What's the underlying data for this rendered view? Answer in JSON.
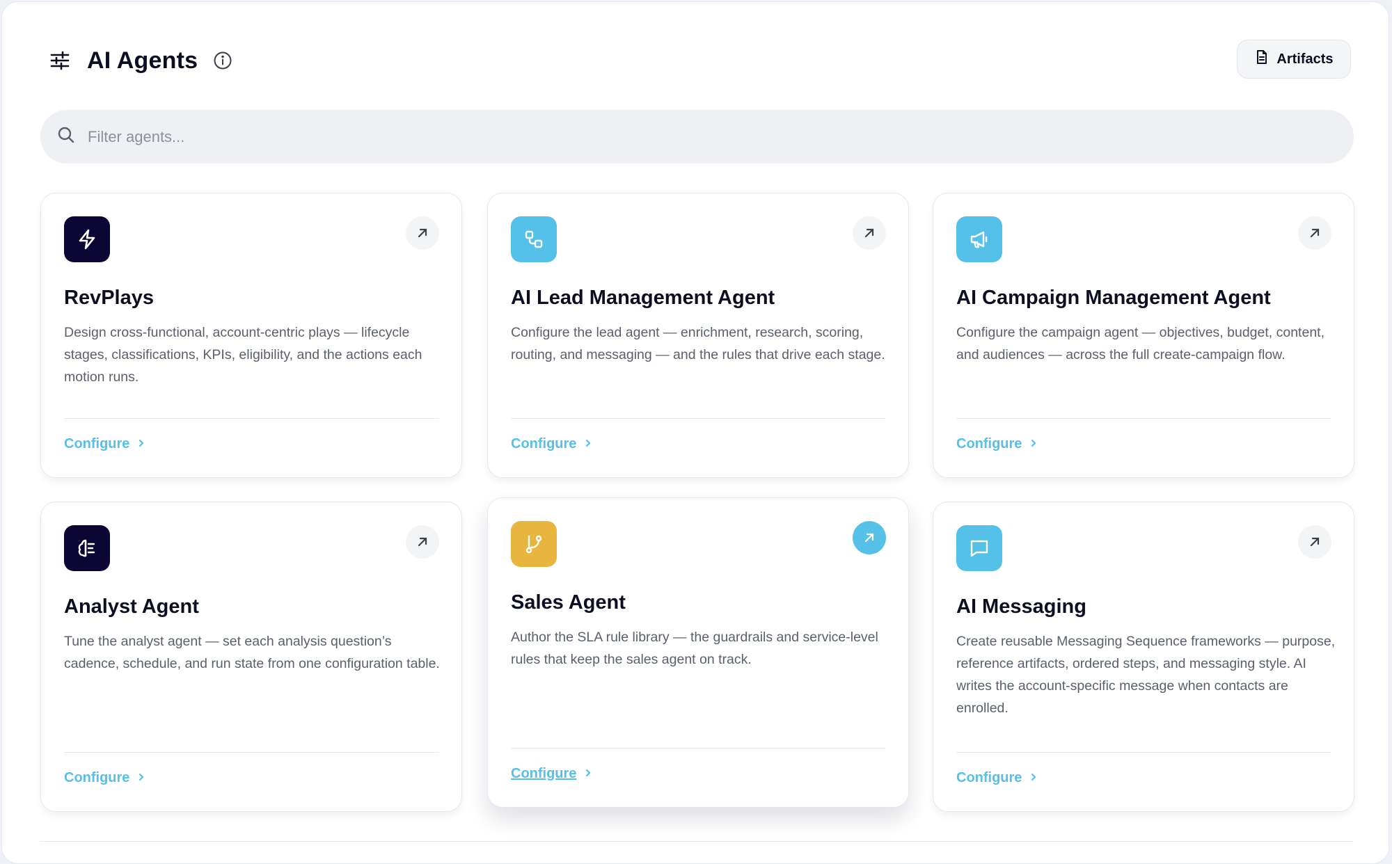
{
  "header": {
    "title": "AI Agents"
  },
  "toolbar": {
    "artifacts_label": "Artifacts"
  },
  "search": {
    "placeholder": "Filter agents..."
  },
  "colors": {
    "accent": "#55c0e8",
    "navy": "#0b0633",
    "amber": "#e8b53e"
  },
  "cards": [
    {
      "title": "RevPlays",
      "description": "Design cross-functional, account-centric plays — lifecycle stages, classifications, KPIs, eligibility, and the actions each motion runs.",
      "icon": "lightning-icon",
      "icon_color": "#0b0633",
      "configure_label": "Configure"
    },
    {
      "title": "AI Lead Management Agent",
      "description": "Configure the lead agent — enrichment, research, scoring, routing, and messaging — and the rules that drive each stage.",
      "icon": "workflow-icon",
      "icon_color": "#55c0e8",
      "configure_label": "Configure"
    },
    {
      "title": "AI Campaign Management Agent",
      "description": "Configure the campaign agent — objectives, budget, content, and audiences — across the full create-campaign flow.",
      "icon": "megaphone-icon",
      "icon_color": "#55c0e8",
      "configure_label": "Configure"
    },
    {
      "title": "Analyst Agent",
      "description": "Tune the analyst agent — set each analysis question’s cadence, schedule, and run state from one configuration table.",
      "icon": "brain-icon",
      "icon_color": "#0b0633",
      "configure_label": "Configure"
    },
    {
      "title": "Sales Agent",
      "description": "Author the SLA rule library — the guardrails and service-level rules that keep the sales agent on track.",
      "icon": "git-branch-icon",
      "icon_color": "#e8b53e",
      "configure_label": "Configure"
    },
    {
      "title": "AI Messaging",
      "description": "Create reusable Messaging Sequence frameworks — purpose, reference artifacts, ordered steps, and messaging style. AI writes the account-specific message when contacts are enrolled.",
      "icon": "message-icon",
      "icon_color": "#55c0e8",
      "configure_label": "Configure"
    }
  ]
}
